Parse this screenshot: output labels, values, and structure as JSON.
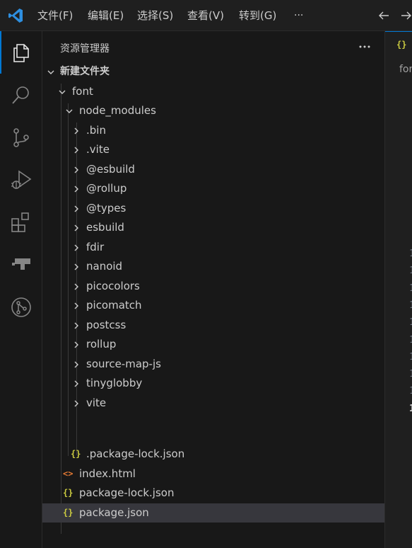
{
  "menu": [
    "文件(F)",
    "编辑(E)",
    "选择(S)",
    "查看(V)",
    "转到(G)"
  ],
  "menu_more": "···",
  "sidebar": {
    "title": "资源管理器",
    "more": "···"
  },
  "tree": {
    "root": "新建文件夹",
    "font": "font",
    "node_modules": "node_modules",
    "folders": [
      ".bin",
      ".vite",
      "@esbuild",
      "@rollup",
      "@types",
      "esbuild",
      "fdir",
      "nanoid",
      "picocolors",
      "picomatch",
      "postcss",
      "rollup",
      "source-map-js",
      "tinyglobby",
      "vite"
    ],
    "inner_file": ".package-lock.json",
    "files": [
      {
        "name": "index.html",
        "icon": "<>"
      },
      {
        "name": "package-lock.json",
        "icon": "{}"
      },
      {
        "name": "package.json",
        "icon": "{}"
      }
    ]
  },
  "editor": {
    "tab_icon": "{}",
    "breadcrumb": "font",
    "line_numbers": [
      "1",
      "1",
      "1",
      "1",
      "1",
      "1",
      "1",
      "1",
      "1",
      "1"
    ]
  },
  "colors": {
    "accent": "#0078d4",
    "json_icon": "#cbcb41",
    "html_icon": "#e37933",
    "selected_row": "#37373d"
  }
}
